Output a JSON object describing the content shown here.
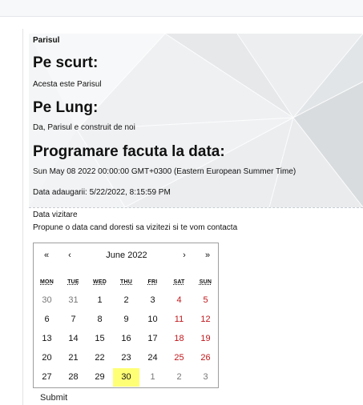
{
  "place": {
    "name": "Parisul",
    "short_heading": "Pe scurt:",
    "short_text": "Acesta este Parisul",
    "long_heading": "Pe Lung:",
    "long_text": "Da, Parisul e construit de noi",
    "date_heading": "Programare facuta la data:",
    "date_text": "Sun May 08 2022 00:00:00 GMT+0300 (Eastern European Summer Time)",
    "added_text": "Data adaugarii: 5/22/2022, 8:15:59 PM"
  },
  "visit": {
    "label": "Data vizitare",
    "hint": "Propune o data cand doresti sa vizitezi si te vom contacta"
  },
  "calendar": {
    "prev_year": "«",
    "prev_month": "‹",
    "title": "June 2022",
    "next_month": "›",
    "next_year": "»",
    "weekdays": [
      "MON",
      "TUE",
      "WED",
      "THU",
      "FRI",
      "SAT",
      "SUN"
    ],
    "weeks": [
      [
        "30",
        "31",
        "1",
        "2",
        "3",
        "4",
        "5"
      ],
      [
        "6",
        "7",
        "8",
        "9",
        "10",
        "11",
        "12"
      ],
      [
        "13",
        "14",
        "15",
        "16",
        "17",
        "18",
        "19"
      ],
      [
        "20",
        "21",
        "22",
        "23",
        "24",
        "25",
        "26"
      ],
      [
        "27",
        "28",
        "29",
        "30",
        "1",
        "2",
        "3"
      ]
    ],
    "selected_day": "30",
    "colors": {
      "weekend": "#c0161a",
      "selected": "#ffff76",
      "other_month": "#777777"
    }
  },
  "submit_label": "Submit"
}
